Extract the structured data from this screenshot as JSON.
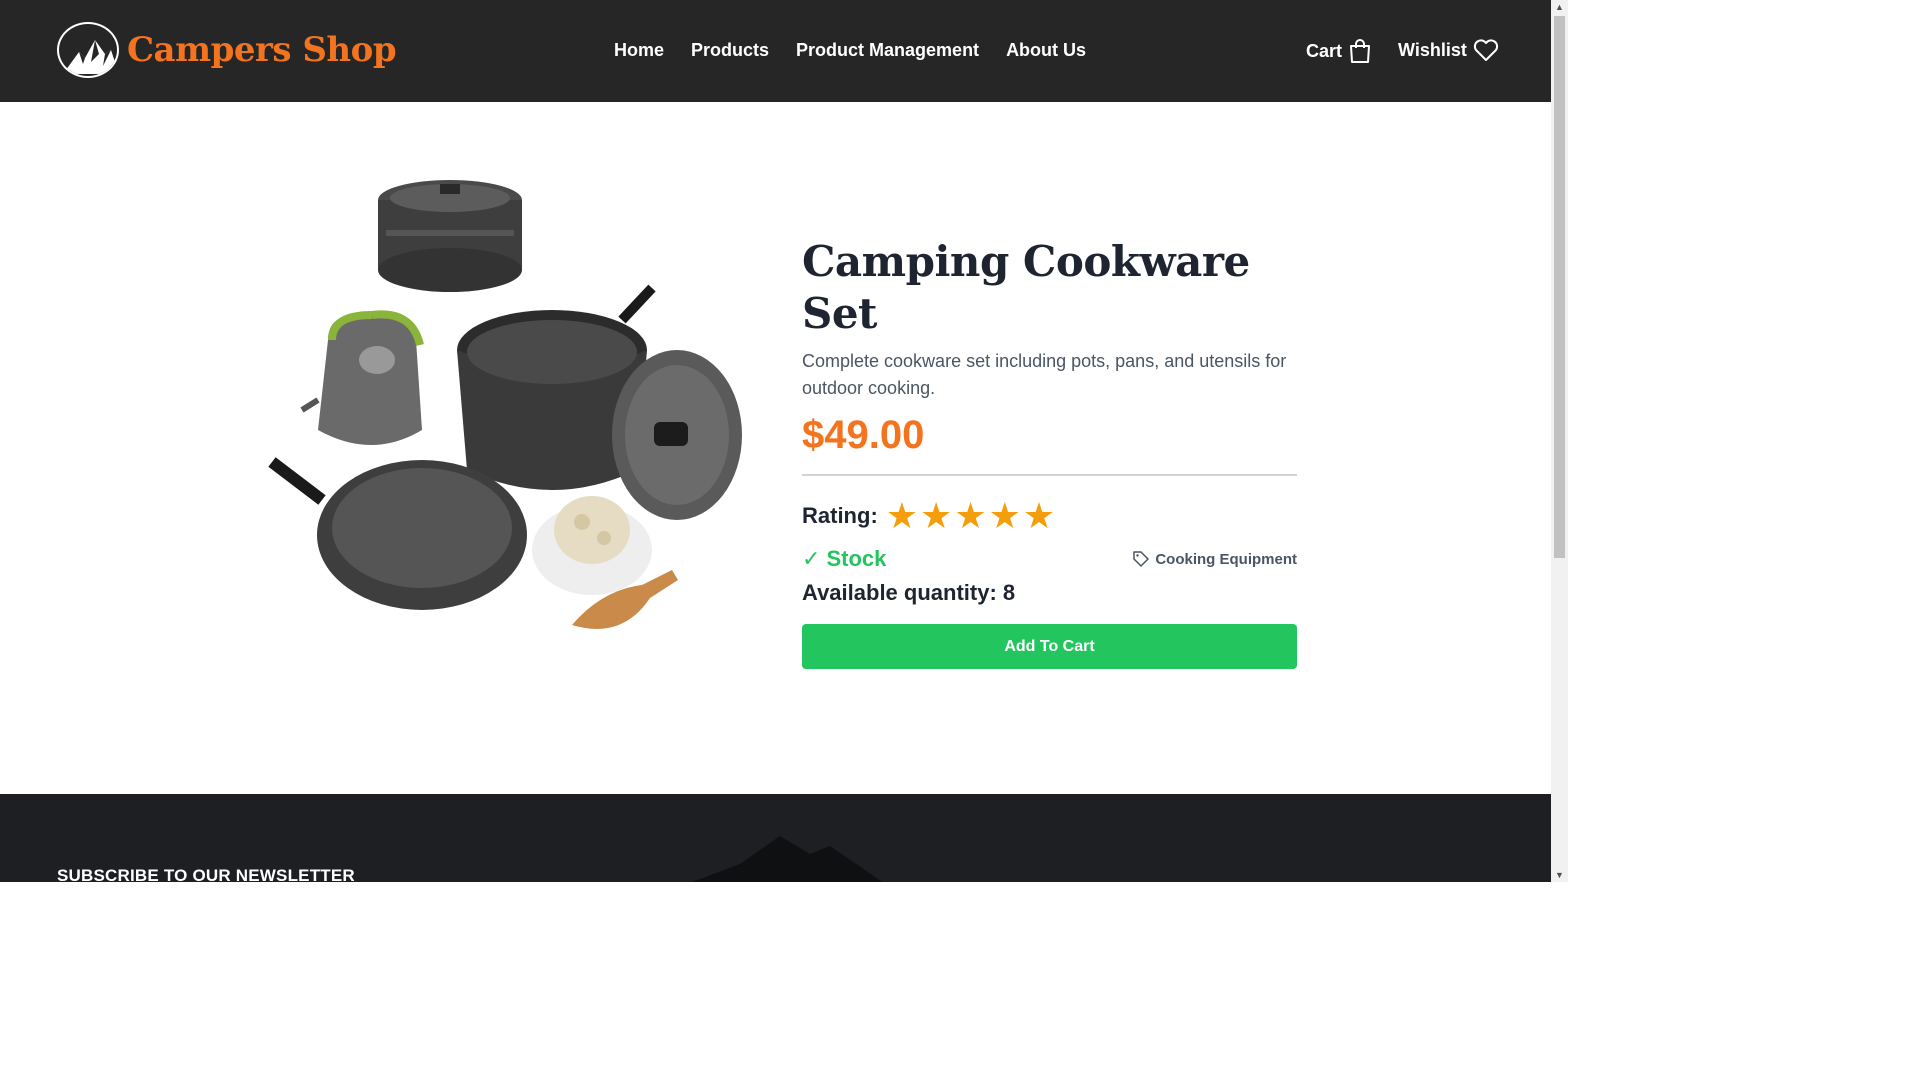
{
  "header": {
    "logo_text": "Campers Shop",
    "nav": [
      "Home",
      "Products",
      "Product Management",
      "About Us"
    ],
    "cart_label": "Cart",
    "wishlist_label": "Wishlist"
  },
  "product": {
    "title": "Camping Cookware Set",
    "description": "Complete cookware set including pots, pans, and utensils for outdoor cooking.",
    "price": "$49.00",
    "rating_label": "Rating:",
    "rating": 5,
    "stock_label": "Stock",
    "category": "Cooking Equipment",
    "quantity_text": "Available quantity: 8",
    "add_button": "Add To Cart"
  },
  "footer": {
    "newsletter_title": "SUBSCRIBE TO OUR NEWSLETTER"
  },
  "colors": {
    "accent": "#f4731f",
    "success": "#22c55e",
    "header_bg": "#262626",
    "star": "#f59e0b"
  }
}
